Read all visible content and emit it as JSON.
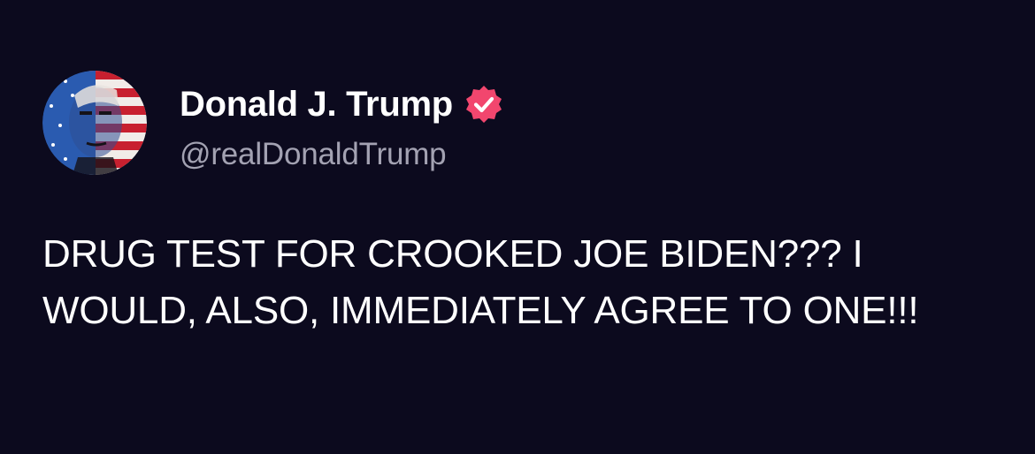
{
  "post": {
    "author": {
      "display_name": "Donald J. Trump",
      "handle": "@realDonaldTrump",
      "avatar_icon": "flag-portrait-avatar",
      "verified_icon": "verified-badge-icon"
    },
    "body": "DRUG TEST FOR CROOKED JOE BIDEN??? I WOULD, ALSO, IMMEDIATELY AGREE TO ONE!!!"
  },
  "colors": {
    "background": "#0c0a1e",
    "text_primary": "#ffffff",
    "text_secondary": "#a3a2b2",
    "verified_badge": "#f2466e"
  }
}
